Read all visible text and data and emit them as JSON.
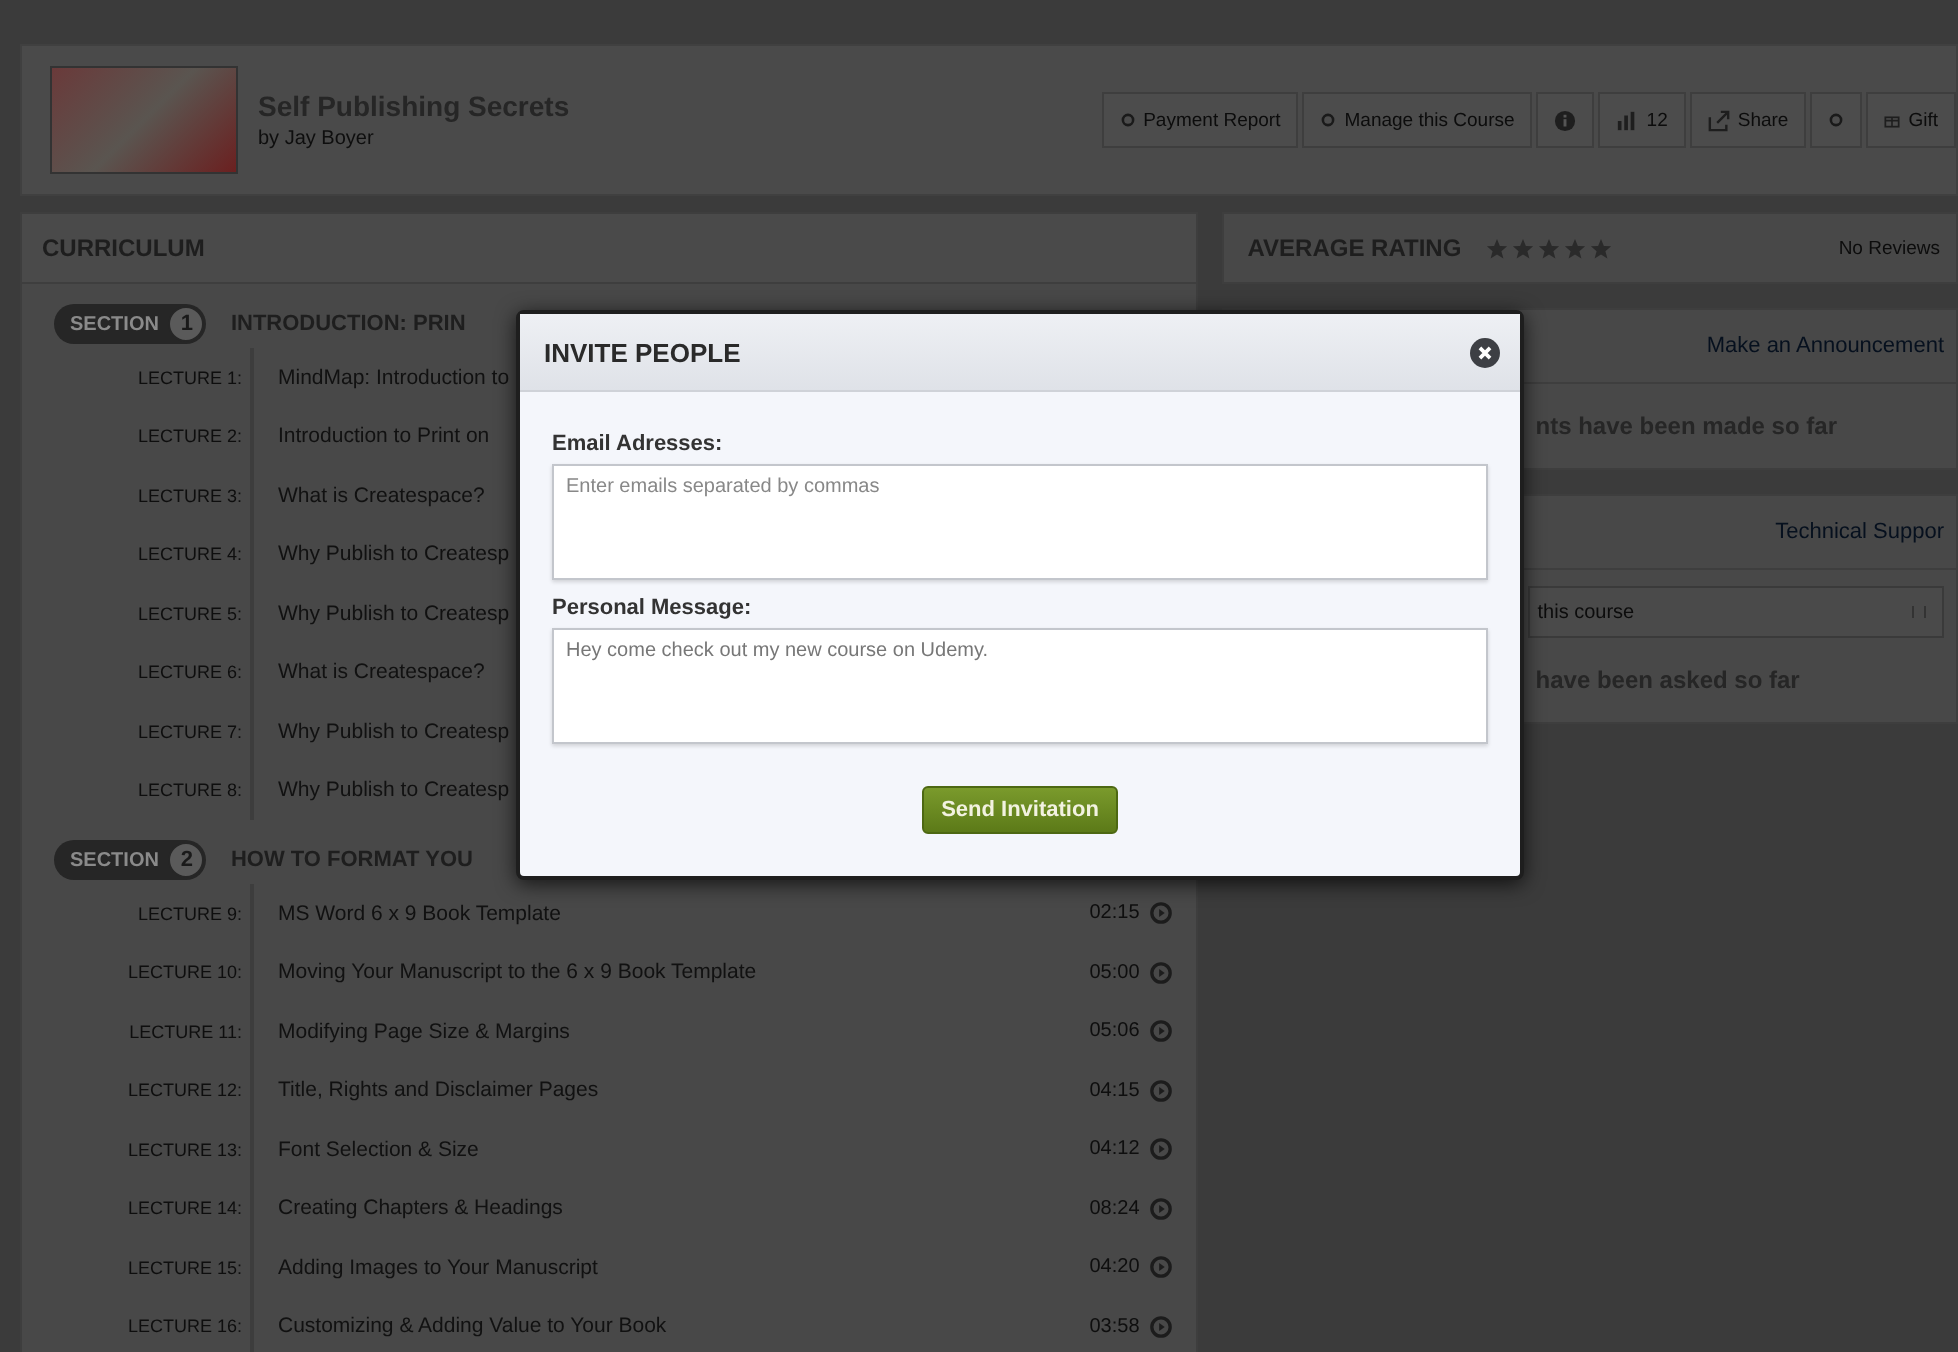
{
  "header": {
    "title": "Self Publishing Secrets",
    "author": "by Jay Boyer",
    "actions": [
      {
        "kind": "dot",
        "label": "Payment Report"
      },
      {
        "kind": "dot",
        "label": "Manage this Course"
      },
      {
        "kind": "info"
      },
      {
        "kind": "chart",
        "label": "12"
      },
      {
        "kind": "share",
        "label": "Share"
      },
      {
        "kind": "dot"
      },
      {
        "kind": "gift",
        "label": "Gift"
      }
    ]
  },
  "curriculum": {
    "title": "CURRICULUM",
    "sections": [
      {
        "badge": "SECTION",
        "number": "1",
        "title": "INTRODUCTION: PRIN",
        "lectures": [
          {
            "label": "LECTURE 1:",
            "title": "MindMap: Introduction to"
          },
          {
            "label": "LECTURE 2:",
            "title": "Introduction to Print on"
          },
          {
            "label": "LECTURE 3:",
            "title": "What is Createspace?"
          },
          {
            "label": "LECTURE 4:",
            "title": "Why Publish to Createsp"
          },
          {
            "label": "LECTURE 5:",
            "title": "Why Publish to Createsp"
          },
          {
            "label": "LECTURE 6:",
            "title": "What is Createspace?"
          },
          {
            "label": "LECTURE 7:",
            "title": "Why Publish to Createsp"
          },
          {
            "label": "LECTURE 8:",
            "title": "Why Publish to Createsp"
          }
        ]
      },
      {
        "badge": "SECTION",
        "number": "2",
        "title": "HOW TO FORMAT YOU",
        "lectures": [
          {
            "label": "LECTURE 9:",
            "title": "MS Word 6 x 9 Book Template",
            "time": "02:15"
          },
          {
            "label": "LECTURE 10:",
            "title": "Moving Your Manuscript to the 6 x 9 Book Template",
            "time": "05:00"
          },
          {
            "label": "LECTURE 11:",
            "title": "Modifying Page Size & Margins",
            "time": "05:06"
          },
          {
            "label": "LECTURE 12:",
            "title": "Title, Rights and Disclaimer Pages",
            "time": "04:15"
          },
          {
            "label": "LECTURE 13:",
            "title": "Font Selection & Size",
            "time": "04:12"
          },
          {
            "label": "LECTURE 14:",
            "title": "Creating Chapters & Headings",
            "time": "08:24"
          },
          {
            "label": "LECTURE 15:",
            "title": "Adding Images to Your Manuscript",
            "time": "04:20"
          },
          {
            "label": "LECTURE 16:",
            "title": "Customizing & Adding Value to Your Book",
            "time": "03:58"
          }
        ]
      }
    ]
  },
  "rating": {
    "title": "AVERAGE RATING",
    "stars": 0,
    "reviews": "No Reviews"
  },
  "announcements": {
    "link": "Make an Announcement",
    "empty": "nts have been made so far"
  },
  "questions": {
    "link": "Technical Suppor",
    "field": "this course",
    "empty": "have been asked so far"
  },
  "modal": {
    "title": "INVITE PEOPLE",
    "email_label": "Email Adresses:",
    "email_placeholder": "Enter emails separated by commas",
    "message_label": "Personal Message:",
    "message_value": "Hey come check out my new course on Udemy.",
    "button": "Send Invitation"
  }
}
